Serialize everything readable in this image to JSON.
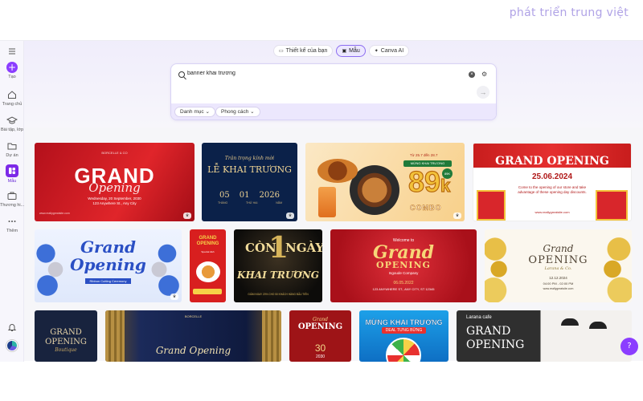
{
  "watermark": "phát triển trung việt",
  "sidebar": {
    "items": [
      {
        "label": "Tạo"
      },
      {
        "label": "Trang chủ"
      },
      {
        "label": "Bài tập, lớp"
      },
      {
        "label": "Dự án"
      },
      {
        "label": "Mẫu"
      },
      {
        "label": "Thương hi..."
      },
      {
        "label": "Thêm"
      }
    ]
  },
  "tabs": [
    {
      "label": "Thiết kế của bạn",
      "icon": "folder-icon"
    },
    {
      "label": "Mẫu",
      "icon": "template-icon",
      "active": true
    },
    {
      "label": "Canva AI",
      "icon": "sparkle-icon"
    }
  ],
  "search": {
    "value": "banner khai trương",
    "placeholder": ""
  },
  "filters": [
    {
      "label": "Danh mục"
    },
    {
      "label": "Phong cách"
    }
  ],
  "cards": {
    "c1": {
      "brand": "BORCELLE & CO",
      "title": "GRAND",
      "script": "Opening",
      "date": "Wednesday, 20 September, 2030",
      "address": "123 Anywhere St., Any City",
      "url": "www.reallygreatsite.com"
    },
    "c2": {
      "top": "Trân trọng kính mời",
      "title": "LỄ KHAI TRƯƠNG",
      "d1": "05",
      "d2": "01",
      "d3": "2026",
      "l1": "THÁNG",
      "l2": "THỨ HAI",
      "l3": "NĂM"
    },
    "c3": {
      "promo": "Từ 25.7 đến 28.7",
      "tag": "MỪNG KHAI TRƯƠNG",
      "price": "89",
      "unit": "k",
      "combo": "COMBO",
      "badge": "89K"
    },
    "c4": {
      "title": "GRAND OPENING",
      "date": "25.06.2024",
      "desc": "Come to the opening of our store and take advantage of these opening day discounts.",
      "url": "www.reallygreatsite.com"
    },
    "c5": {
      "script1": "Grand",
      "script2": "Opening",
      "sub": "Ribbon Cutting Ceremony"
    },
    "c6": {
      "title": "GRAND OPENING",
      "sub": "Special dish"
    },
    "c7": {
      "line1": "CÒN",
      "num": "1",
      "line2": "NGÀY",
      "line3": "KHAI TRƯƠNG",
      "foot": "GIẢM NGAY 20% CHO 50 KHÁCH HÀNG ĐẦU TIÊN"
    },
    "c8": {
      "welcome": "Welcome to",
      "title": "Grand",
      "title2": "OPENING",
      "company": "Ingoude Company",
      "date": "06.05.2022",
      "address": "123 ANYWHERE ST., ANY CITY, ST 12345"
    },
    "c9": {
      "title": "Grand",
      "title2": "OPENING",
      "sub": "Larana & Co.",
      "date": "12.12.2024",
      "time": "04:00 PM - 02:00 PM",
      "url": "www.reallygreatsite.com"
    },
    "c10": {
      "t1": "GRAND",
      "t2": "OPENING",
      "t3": "Boutique"
    },
    "c11": {
      "script": "Grand Opening",
      "brand": "BORCELLE"
    },
    "c12": {
      "t1": "Grand",
      "t2": "OPENING",
      "d1": "30",
      "d2": "2030"
    },
    "c13": {
      "title": "MỪNG KHAI TRƯƠNG",
      "sub": "DEAL TƯNG BỪNG"
    },
    "c14": {
      "brand": "Larana cafe",
      "t1": "GRAND",
      "t2": "OPENING"
    }
  },
  "help_label": "?"
}
